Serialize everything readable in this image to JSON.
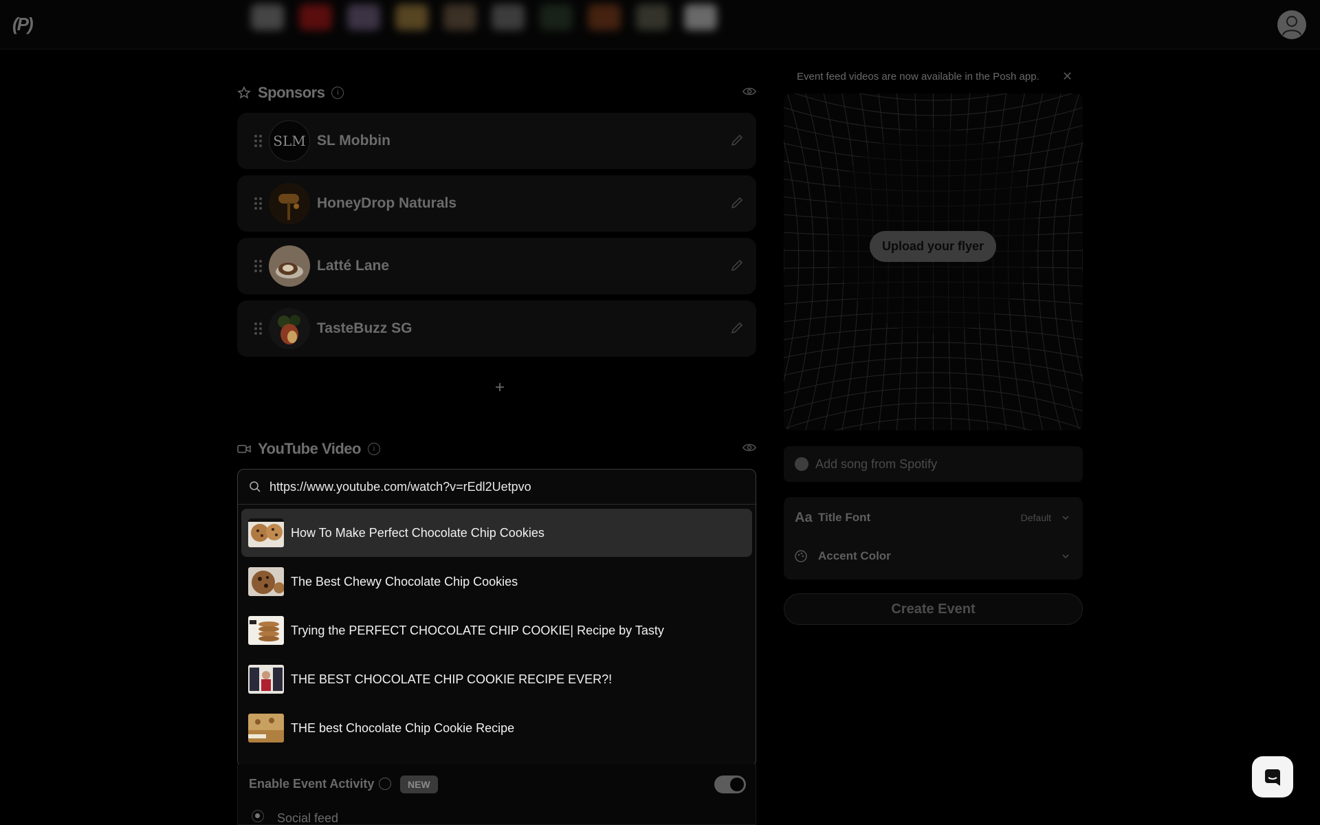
{
  "header": {
    "logo_text": "(P)",
    "avatar": "user-avatar-icon"
  },
  "sponsors": {
    "title": "Sponsors",
    "items": [
      {
        "name": "SL Mobbin",
        "logo_text": "SLM"
      },
      {
        "name": "HoneyDrop Naturals"
      },
      {
        "name": "Latté Lane"
      },
      {
        "name": "TasteBuzz SG"
      }
    ],
    "add_label": "+"
  },
  "youtube": {
    "title": "YouTube Video",
    "url_value": "https://www.youtube.com/watch?v=rEdl2Uetpvo",
    "results": [
      {
        "title": "How To Make Perfect Chocolate Chip Cookies",
        "selected": true
      },
      {
        "title": "The Best Chewy Chocolate Chip Cookies"
      },
      {
        "title": "Trying the PERFECT CHOCOLATE CHIP COOKIE| Recipe by Tasty"
      },
      {
        "title": "THE BEST CHOCOLATE CHIP COOKIE RECIPE EVER?!"
      },
      {
        "title": "THE best Chocolate Chip Cookie Recipe"
      }
    ]
  },
  "activity": {
    "label": "Enable Event Activity",
    "badge": "NEW",
    "toggle_on": true,
    "option": "Social feed"
  },
  "right": {
    "notice": "Event feed videos are now available in the Posh app.",
    "upload_label": "Upload your flyer",
    "spotify_placeholder": "Add song from Spotify",
    "title_font_icon": "Aa",
    "title_font_label": "Title Font",
    "title_font_value": "Default",
    "accent_label": "Accent Color",
    "create_label": "Create Event"
  }
}
